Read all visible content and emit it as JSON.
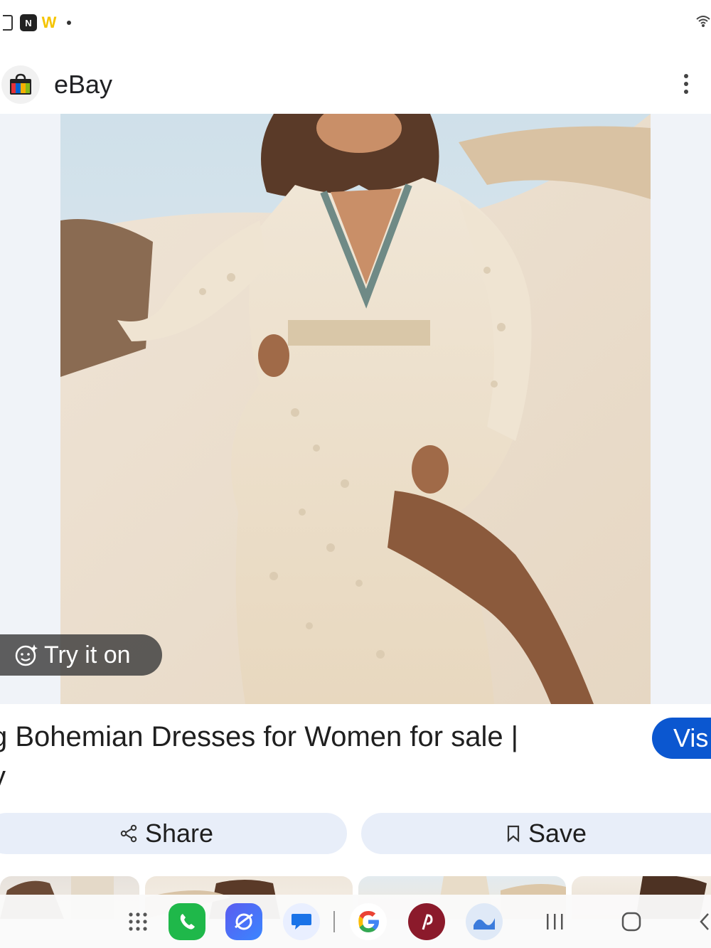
{
  "status_bar": {
    "left_icons": [
      "screen-cast-icon",
      "n-app-icon",
      "w-app-icon",
      "dot-icon"
    ],
    "right_icons": [
      "wifi-icon"
    ]
  },
  "header": {
    "site_name": "eBay",
    "logo_icon": "shopping-bag-icon",
    "menu_icon": "more-vert-icon"
  },
  "viewer": {
    "try_on_label": "Try it on",
    "try_on_icon": "face-sparkle-icon"
  },
  "result": {
    "title": "g Bohemian Dresses for Women for sale |",
    "title_line2": "y",
    "visit_label": "Vis"
  },
  "actions": {
    "share_label": "Share",
    "save_label": "Save"
  },
  "dock": {
    "apps": [
      "app-drawer-icon",
      "phone-icon",
      "internet-icon",
      "messages-icon",
      "google-icon",
      "app-icon",
      "bixby-icon"
    ],
    "nav": [
      "recents-icon",
      "home-icon",
      "back-icon"
    ]
  },
  "colors": {
    "accent": "#0b57d0",
    "action_bg": "#e8eef9",
    "viewer_bg": "#f0f3f8"
  }
}
